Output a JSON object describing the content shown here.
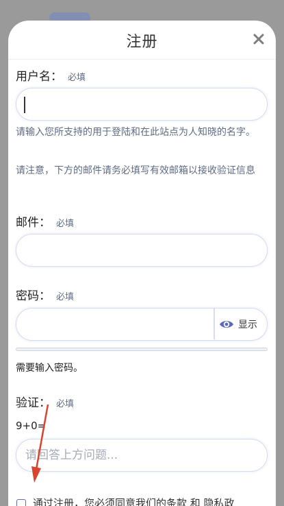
{
  "dialog": {
    "title": "注册"
  },
  "fields": {
    "required_tag": "必填",
    "username": {
      "label": "用户名：",
      "value": "",
      "help_1": "请输入您所支持的用于登陆和在此站点为人知晓的名字。",
      "help_2": "请注意，下方的邮件请务必填写有效邮箱以接收验证信息"
    },
    "email": {
      "label": "邮件：",
      "value": ""
    },
    "password": {
      "label": "密码：",
      "value": "",
      "show_label": "显示",
      "hint": "需要输入密码。"
    },
    "captcha": {
      "label": "验证：",
      "question": "9+0=",
      "placeholder": "请回答上方问题..."
    }
  },
  "terms": {
    "text": "通过注册，您必须同意我们的条款 和 隐私政"
  },
  "colors": {
    "accent": "#5a6bbf",
    "help_text": "#5e6c85",
    "input_border": "#d7dcee",
    "annotation_arrow": "#d9442f"
  },
  "icons": [
    "close-icon",
    "eye-icon",
    "checkbox-icon"
  ]
}
